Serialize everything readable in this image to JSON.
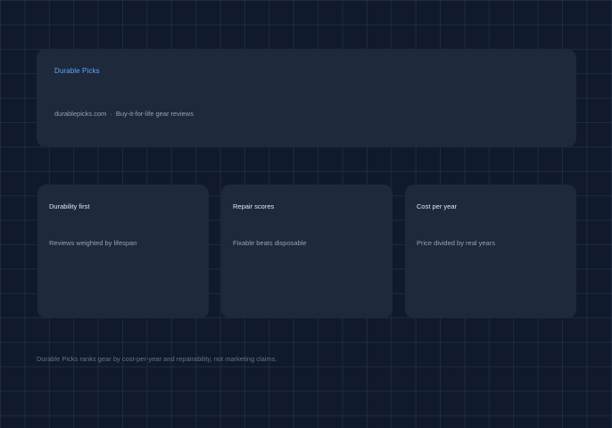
{
  "hero": {
    "brand": "Durable Picks",
    "domain": "durablepicks.com",
    "separator": "·",
    "tagline": "Buy-it-for-life gear reviews"
  },
  "cards": [
    {
      "title": "Durability first",
      "description": "Reviews weighted by lifespan"
    },
    {
      "title": "Repair scores",
      "description": "Fixable beats disposable"
    },
    {
      "title": "Cost per year",
      "description": "Price divided by real years"
    }
  ],
  "footer": {
    "note": "Durable Picks ranks gear by cost-per-year and repairability, not marketing claims."
  }
}
